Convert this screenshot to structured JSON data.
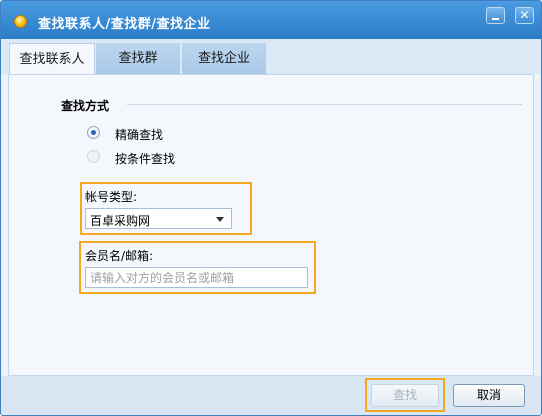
{
  "window": {
    "title": "查找联系人/查找群/查找企业"
  },
  "tabs": [
    {
      "label": "查找联系人",
      "active": true
    },
    {
      "label": "查找群",
      "active": false
    },
    {
      "label": "查找企业",
      "active": false
    }
  ],
  "search_mode": {
    "label": "查找方式",
    "options": [
      {
        "label": "精确查找",
        "checked": true
      },
      {
        "label": "按条件查找",
        "checked": false
      }
    ]
  },
  "account_type": {
    "label": "帐号类型:",
    "value": "百卓采购网"
  },
  "member_name": {
    "label": "会员名/邮箱:",
    "placeholder": "请输入对方的会员名或邮箱",
    "value": ""
  },
  "buttons": {
    "find": "查找",
    "cancel": "取消"
  },
  "colors": {
    "highlight": "#f5a623",
    "titlebar": "#2a7cc7"
  }
}
